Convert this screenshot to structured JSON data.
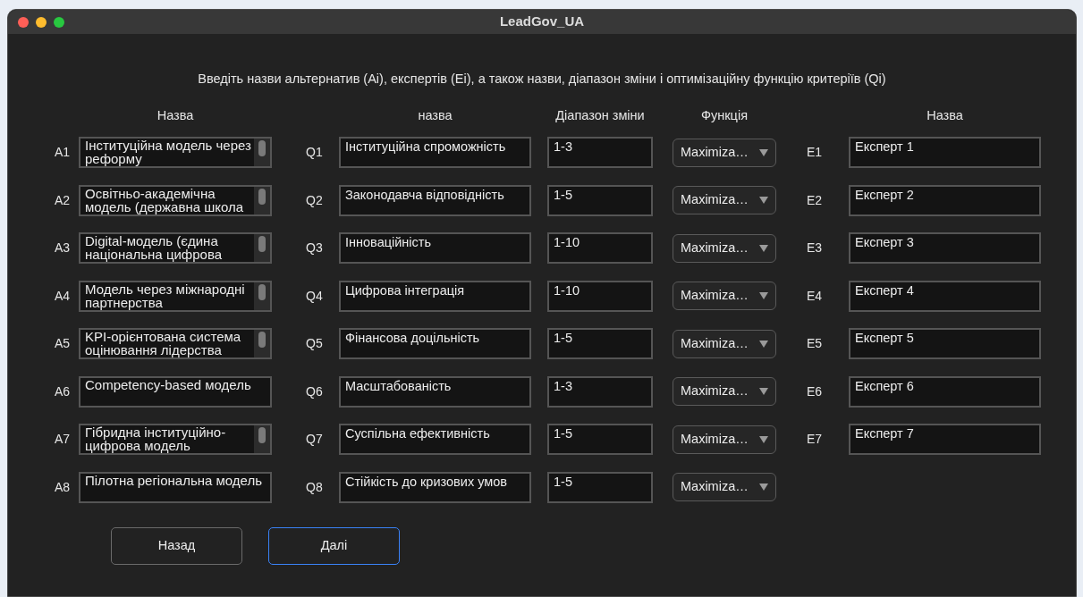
{
  "window": {
    "title": "LeadGov_UA"
  },
  "instruction": "Введіть назви альтернатив (Ai), експертів (Ei), а також назви, діапазон зміни і оптимізаційну функцію критеріїв (Qi)",
  "headers": {
    "alternatives": "Назва",
    "criteria_name": "назва",
    "range": "Діапазон зміни",
    "function": "Функція",
    "experts": "Назва"
  },
  "alternatives": [
    {
      "label": "A1",
      "value": "Інституційна модель через реформу",
      "scrollbar": true
    },
    {
      "label": "A2",
      "value": "Освітньо-академічна модель (державна школа",
      "scrollbar": true
    },
    {
      "label": "A3",
      "value": "Digital-модель (єдина національна цифрова",
      "scrollbar": true
    },
    {
      "label": "A4",
      "value": "Модель через міжнародні партнерства",
      "scrollbar": true
    },
    {
      "label": "A5",
      "value": "KPI-орієнтована система оцінювання лідерства",
      "scrollbar": true
    },
    {
      "label": "A6",
      "value": "Competency-based модель",
      "scrollbar": false
    },
    {
      "label": "A7",
      "value": "Гібридна інституційно-цифрова модель",
      "scrollbar": true
    },
    {
      "label": "A8",
      "value": "Пілотна регіональна модель",
      "scrollbar": false
    }
  ],
  "criteria": [
    {
      "label": "Q1",
      "name": "Інституційна спроможність",
      "range": "1-3",
      "function": "Maximiza…"
    },
    {
      "label": "Q2",
      "name": "Законодавча відповідність",
      "range": "1-5",
      "function": "Maximiza…"
    },
    {
      "label": "Q3",
      "name": "Інноваційність",
      "range": "1-10",
      "function": "Maximiza…"
    },
    {
      "label": "Q4",
      "name": "Цифрова інтеграція",
      "range": "1-10",
      "function": "Maximiza…"
    },
    {
      "label": "Q5",
      "name": "Фінансова доцільність",
      "range": "1-5",
      "function": "Maximiza…"
    },
    {
      "label": "Q6",
      "name": "Масштабованість",
      "range": "1-3",
      "function": "Maximiza…"
    },
    {
      "label": "Q7",
      "name": "Суспільна ефективність",
      "range": "1-5",
      "function": "Maximiza…"
    },
    {
      "label": "Q8",
      "name": "Стійкість до кризових умов",
      "range": "1-5",
      "function": "Maximiza…"
    }
  ],
  "experts": [
    {
      "label": "E1",
      "value": "Експерт 1"
    },
    {
      "label": "E2",
      "value": "Експерт 2"
    },
    {
      "label": "E3",
      "value": "Експерт 3"
    },
    {
      "label": "E4",
      "value": "Експерт 4"
    },
    {
      "label": "E5",
      "value": "Експерт 5"
    },
    {
      "label": "E6",
      "value": "Експерт 6"
    },
    {
      "label": "E7",
      "value": "Експерт 7"
    }
  ],
  "buttons": [
    {
      "label": "Назад",
      "selected": false
    },
    {
      "label": "Далі",
      "selected": true
    }
  ]
}
